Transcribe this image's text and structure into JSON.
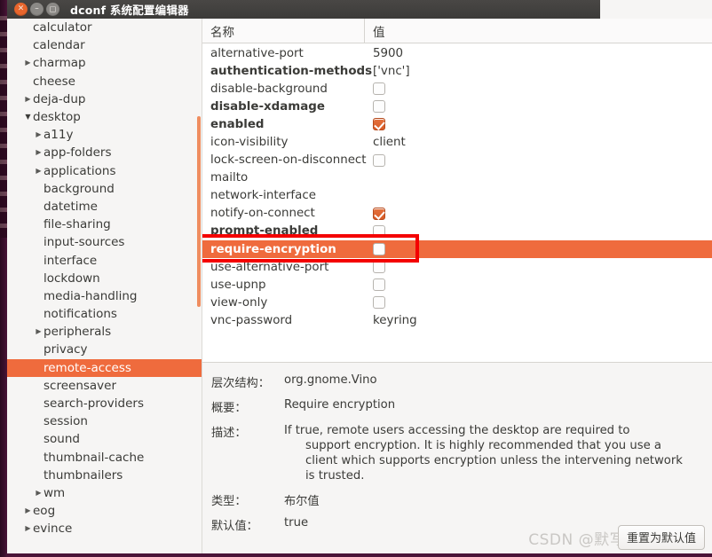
{
  "window": {
    "title": "dconf 系统配置编辑器",
    "controls": {
      "close_label": "×",
      "minimize_label": "–",
      "maximize_label": "□"
    }
  },
  "sidebar": {
    "items": [
      {
        "label": "calculator",
        "depth": 1,
        "arrow": "none",
        "selected": false
      },
      {
        "label": "calendar",
        "depth": 1,
        "arrow": "none",
        "selected": false
      },
      {
        "label": "charmap",
        "depth": 1,
        "arrow": "collapsed",
        "selected": false
      },
      {
        "label": "cheese",
        "depth": 1,
        "arrow": "none",
        "selected": false
      },
      {
        "label": "deja-dup",
        "depth": 1,
        "arrow": "collapsed",
        "selected": false
      },
      {
        "label": "desktop",
        "depth": 1,
        "arrow": "expanded",
        "selected": false
      },
      {
        "label": "a11y",
        "depth": 2,
        "arrow": "collapsed",
        "selected": false
      },
      {
        "label": "app-folders",
        "depth": 2,
        "arrow": "collapsed",
        "selected": false
      },
      {
        "label": "applications",
        "depth": 2,
        "arrow": "collapsed",
        "selected": false
      },
      {
        "label": "background",
        "depth": 2,
        "arrow": "none",
        "selected": false
      },
      {
        "label": "datetime",
        "depth": 2,
        "arrow": "none",
        "selected": false
      },
      {
        "label": "file-sharing",
        "depth": 2,
        "arrow": "none",
        "selected": false
      },
      {
        "label": "input-sources",
        "depth": 2,
        "arrow": "none",
        "selected": false
      },
      {
        "label": "interface",
        "depth": 2,
        "arrow": "none",
        "selected": false
      },
      {
        "label": "lockdown",
        "depth": 2,
        "arrow": "none",
        "selected": false
      },
      {
        "label": "media-handling",
        "depth": 2,
        "arrow": "none",
        "selected": false
      },
      {
        "label": "notifications",
        "depth": 2,
        "arrow": "none",
        "selected": false
      },
      {
        "label": "peripherals",
        "depth": 2,
        "arrow": "collapsed",
        "selected": false
      },
      {
        "label": "privacy",
        "depth": 2,
        "arrow": "none",
        "selected": false
      },
      {
        "label": "remote-access",
        "depth": 2,
        "arrow": "none",
        "selected": true
      },
      {
        "label": "screensaver",
        "depth": 2,
        "arrow": "none",
        "selected": false
      },
      {
        "label": "search-providers",
        "depth": 2,
        "arrow": "none",
        "selected": false
      },
      {
        "label": "session",
        "depth": 2,
        "arrow": "none",
        "selected": false
      },
      {
        "label": "sound",
        "depth": 2,
        "arrow": "none",
        "selected": false
      },
      {
        "label": "thumbnail-cache",
        "depth": 2,
        "arrow": "none",
        "selected": false
      },
      {
        "label": "thumbnailers",
        "depth": 2,
        "arrow": "none",
        "selected": false
      },
      {
        "label": "wm",
        "depth": 2,
        "arrow": "collapsed",
        "selected": false
      },
      {
        "label": "eog",
        "depth": 1,
        "arrow": "collapsed",
        "selected": false
      },
      {
        "label": "evince",
        "depth": 1,
        "arrow": "collapsed",
        "selected": false
      }
    ]
  },
  "table": {
    "columns": {
      "name": "名称",
      "value": "值"
    },
    "rows": [
      {
        "name": "alternative-port",
        "value": "5900",
        "type": "text",
        "modified": false,
        "selected": false
      },
      {
        "name": "authentication-methods",
        "value": "['vnc']",
        "type": "text",
        "modified": true,
        "selected": false
      },
      {
        "name": "disable-background",
        "value": "false",
        "type": "checkbox",
        "modified": false,
        "selected": false
      },
      {
        "name": "disable-xdamage",
        "value": "false",
        "type": "checkbox",
        "modified": true,
        "selected": false
      },
      {
        "name": "enabled",
        "value": "true",
        "type": "checkbox",
        "modified": true,
        "selected": false
      },
      {
        "name": "icon-visibility",
        "value": "client",
        "type": "text",
        "modified": false,
        "selected": false
      },
      {
        "name": "lock-screen-on-disconnect",
        "value": "false",
        "type": "checkbox",
        "modified": false,
        "selected": false
      },
      {
        "name": "mailto",
        "value": "",
        "type": "text",
        "modified": false,
        "selected": false
      },
      {
        "name": "network-interface",
        "value": "",
        "type": "text",
        "modified": false,
        "selected": false
      },
      {
        "name": "notify-on-connect",
        "value": "true",
        "type": "checkbox",
        "modified": false,
        "selected": false
      },
      {
        "name": "prompt-enabled",
        "value": "false",
        "type": "checkbox",
        "modified": true,
        "selected": false
      },
      {
        "name": "require-encryption",
        "value": "false",
        "type": "checkbox",
        "modified": true,
        "selected": true
      },
      {
        "name": "use-alternative-port",
        "value": "false",
        "type": "checkbox",
        "modified": false,
        "selected": false
      },
      {
        "name": "use-upnp",
        "value": "false",
        "type": "checkbox",
        "modified": false,
        "selected": false
      },
      {
        "name": "view-only",
        "value": "false",
        "type": "checkbox",
        "modified": false,
        "selected": false
      },
      {
        "name": "vnc-password",
        "value": "keyring",
        "type": "text",
        "modified": false,
        "selected": false
      }
    ]
  },
  "detail": {
    "schema_label": "层次结构：",
    "schema_value": "org.gnome.Vino",
    "summary_label": "概要：",
    "summary_value": "Require encryption",
    "description_label": "描述：",
    "description_line1": "If true, remote users accessing the desktop are required to",
    "description_line2": "support encryption. It is highly recommended that you use a",
    "description_line3": "client which supports encryption unless the intervening network",
    "description_line4": "is trusted.",
    "type_label": "类型：",
    "type_value": "布尔值",
    "default_label": "默认值：",
    "default_value": "true",
    "reset_button": "重置为默认值"
  },
  "watermark": {
    "text": "CSDN @默写."
  },
  "colors": {
    "accent": "#ef6b3d",
    "checkbox_on": "#d95b26",
    "annotation": "#f40000",
    "titlebar": "#3c3b39",
    "launcher": "#4b1438"
  }
}
